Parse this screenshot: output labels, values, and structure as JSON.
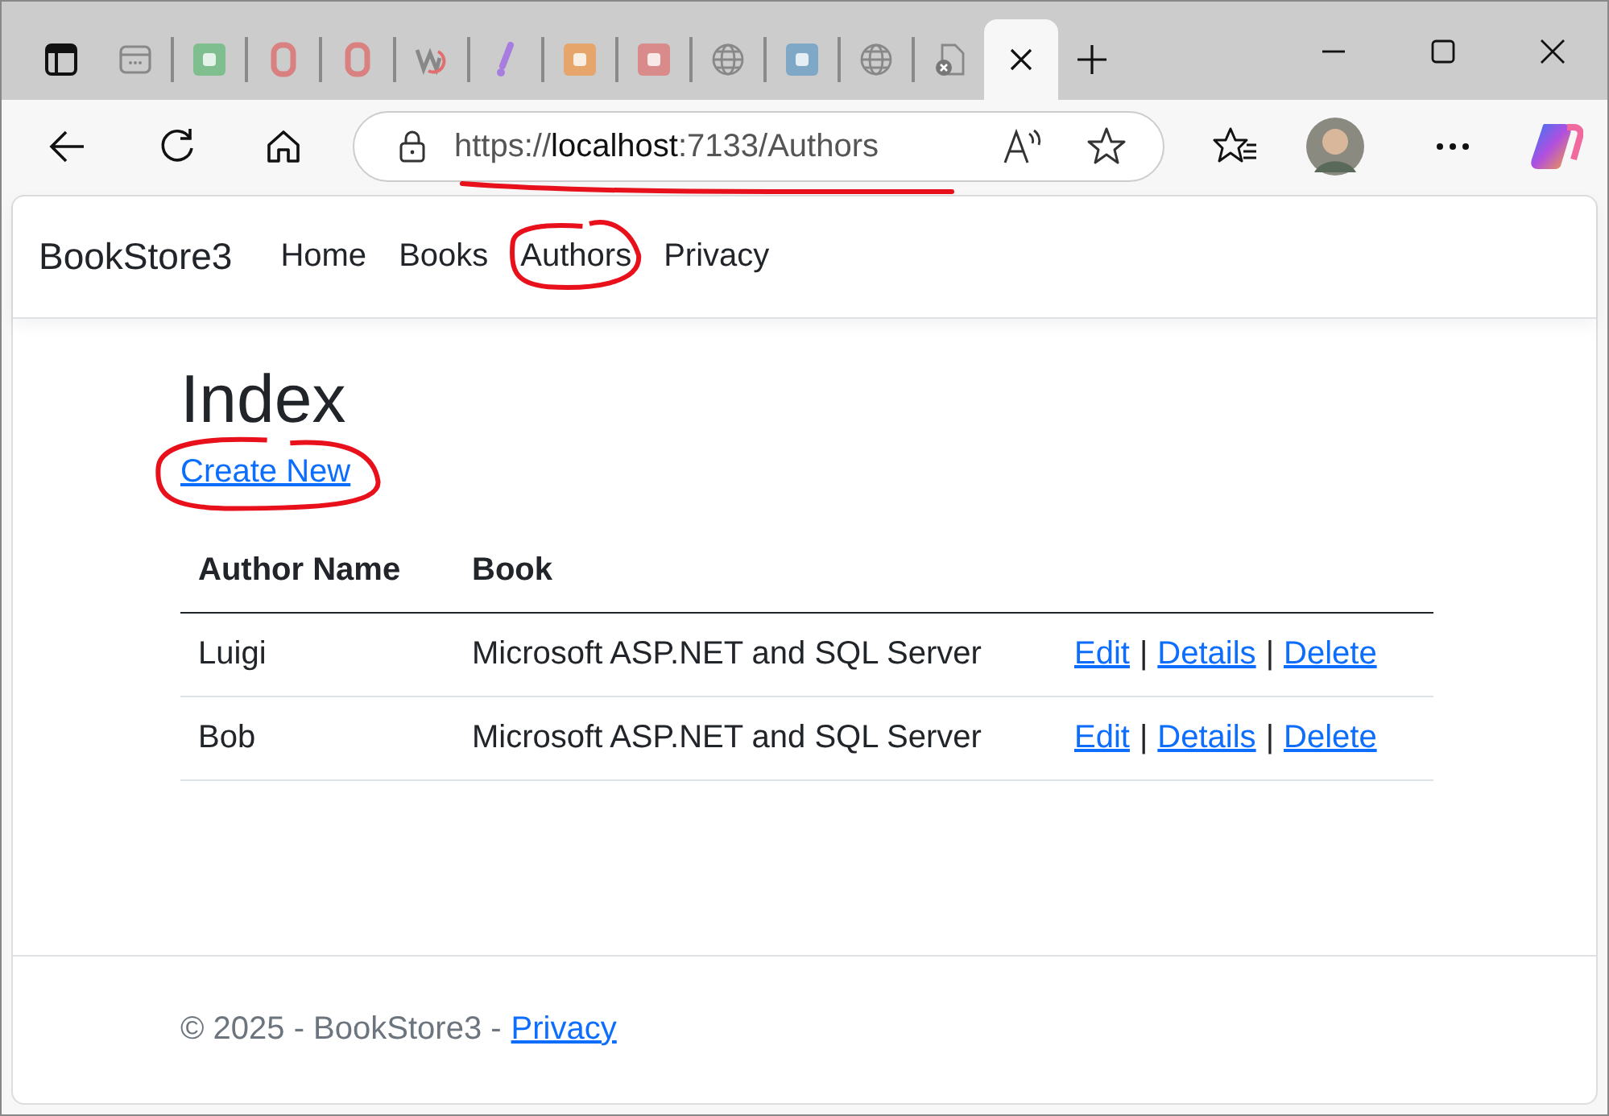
{
  "browser": {
    "tabs": [
      {
        "kind": "app",
        "selected": false
      },
      {
        "kind": "green",
        "selected": false
      },
      {
        "kind": "red",
        "selected": false
      },
      {
        "kind": "red",
        "selected": false
      },
      {
        "kind": "swirl",
        "selected": false
      },
      {
        "kind": "exclaim",
        "selected": false
      },
      {
        "kind": "orange",
        "selected": false
      },
      {
        "kind": "pink",
        "selected": false
      },
      {
        "kind": "globe",
        "selected": false
      },
      {
        "kind": "blue",
        "selected": false
      },
      {
        "kind": "globe",
        "selected": false
      },
      {
        "kind": "doc",
        "selected": false
      },
      {
        "selected": true
      }
    ],
    "address": {
      "scheme": "https://",
      "host": "localhost",
      "path": ":7133/Authors",
      "underlined": true
    }
  },
  "navbar": {
    "brand": "BookStore3",
    "links": [
      {
        "label": "Home",
        "circled": false
      },
      {
        "label": "Books",
        "circled": false
      },
      {
        "label": "Authors",
        "circled": true
      },
      {
        "label": "Privacy",
        "circled": false
      }
    ]
  },
  "heading": "Index",
  "create_link": {
    "label": "Create New",
    "circled": true
  },
  "table": {
    "columns": [
      "Author Name",
      "Book"
    ],
    "rows": [
      {
        "name": "Luigi",
        "book": "Microsoft ASP.NET and SQL Server",
        "links": [
          "Edit",
          "Details",
          "Delete"
        ],
        "separators": [
          "|",
          "|"
        ]
      },
      {
        "name": "Bob",
        "book": "Microsoft ASP.NET and SQL Server",
        "links": [
          "Edit",
          "Details",
          "Delete"
        ],
        "separators": [
          "|",
          "|"
        ]
      }
    ]
  },
  "footer": {
    "text": "© 2025 - BookStore3 -",
    "link": "Privacy"
  }
}
